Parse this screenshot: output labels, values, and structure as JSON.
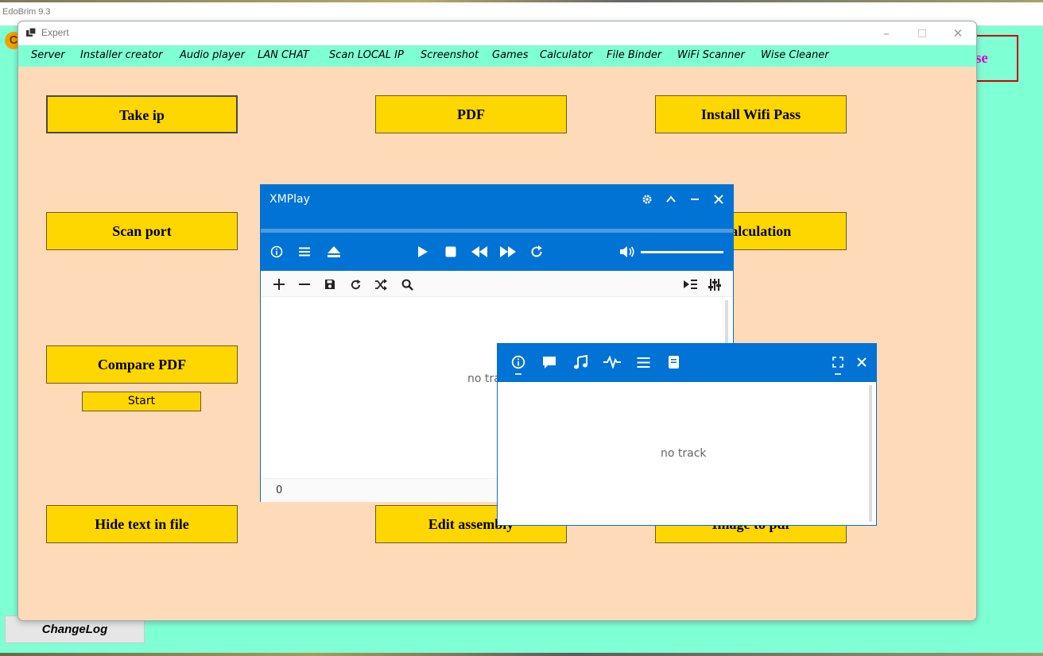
{
  "outer": {
    "title": "EdoBrim 9.3",
    "partial_button_text": "se",
    "changelog_label": "ChangeLog"
  },
  "expert": {
    "title": "Expert",
    "menu": [
      "Server",
      "Installer creator",
      "Audio player",
      "LAN CHAT",
      "Scan LOCAL IP",
      "Screenshot",
      "Games",
      "Calculator",
      "File Binder",
      "WiFi Scanner",
      "Wise Cleaner"
    ],
    "buttons": {
      "take_ip": "Take ip",
      "pdf": "PDF",
      "install_wifi_pass": "Install Wifi Pass",
      "scan_port": "Scan port",
      "calculation": "ic calculation",
      "compare_pdf": "Compare PDF",
      "start": "Start",
      "hide_text": "Hide text in file",
      "edit_assembly": "Edit assembly",
      "image_to_pdf": "Image to pdf"
    }
  },
  "xmplay": {
    "title": "XMPlay",
    "list_empty": "no tra",
    "track_count": "0"
  },
  "info_window": {
    "empty_text": "no track"
  },
  "colors": {
    "desktop": "#7fffd4",
    "expert_bg": "#ffdab9",
    "button_yellow": "#ffd700",
    "xmplay_blue": "#0073d4"
  }
}
